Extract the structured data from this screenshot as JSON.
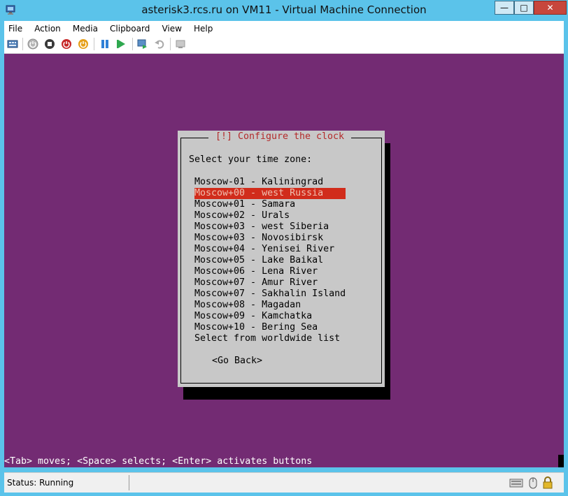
{
  "window": {
    "title": "asterisk3.rcs.ru on VM11 - Virtual Machine Connection"
  },
  "menu": [
    "File",
    "Action",
    "Media",
    "Clipboard",
    "View",
    "Help"
  ],
  "toolbar": [
    {
      "name": "ctrl-alt-del-icon"
    },
    {
      "name": "start-icon"
    },
    {
      "name": "turn-off-icon"
    },
    {
      "name": "shutdown-icon"
    },
    {
      "name": "save-icon"
    },
    {
      "name": "pause-icon"
    },
    {
      "name": "reset-icon"
    },
    {
      "name": "checkpoint-icon"
    },
    {
      "name": "revert-icon"
    },
    {
      "name": "enhanced-session-icon"
    }
  ],
  "dialog": {
    "title": "[!] Configure the clock",
    "prompt": "Select your time zone:",
    "selected_index": 1,
    "options": [
      "Moscow-01 - Kaliningrad",
      "Moscow+00 - west Russia",
      "Moscow+01 - Samara",
      "Moscow+02 - Urals",
      "Moscow+03 - west Siberia",
      "Moscow+03 - Novosibirsk",
      "Moscow+04 - Yenisei River",
      "Moscow+05 - Lake Baikal",
      "Moscow+06 - Lena River",
      "Moscow+07 - Amur River",
      "Moscow+07 - Sakhalin Island",
      "Moscow+08 - Magadan",
      "Moscow+09 - Kamchatka",
      "Moscow+10 - Bering Sea",
      "Select from worldwide list"
    ],
    "go_back": "<Go Back>"
  },
  "hint": "<Tab> moves; <Space> selects; <Enter> activates buttons",
  "status": {
    "text": "Status: Running"
  },
  "colors": {
    "console_bg": "#732b73",
    "selection": "#d12c1b",
    "titlebar": "#5bc3ea"
  }
}
